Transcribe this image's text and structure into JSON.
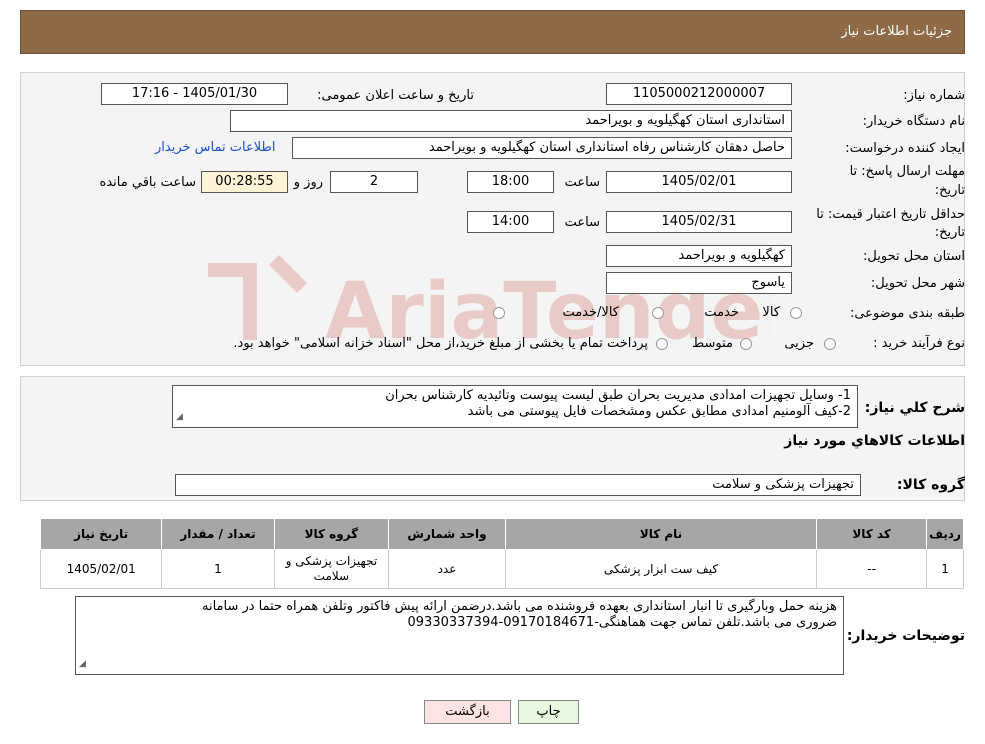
{
  "header": {
    "title": "جزئیات اطلاعات نیاز"
  },
  "form": {
    "need_number_label": "شماره نیاز:",
    "need_number": "1105000212000007",
    "announce_label": "تاریخ و ساعت اعلان عمومی:",
    "announce_value": "1405/01/30 - 17:16",
    "buyer_org_label": "نام دستگاه خریدار:",
    "buyer_org": "استانداری استان کهگیلویه و بویراحمد",
    "requester_label": "ایجاد کننده درخواست:",
    "requester": "حاصل دهقان کارشناس رفاه استانداری استان کهگیلویه و بویراحمد",
    "contact_link": "اطلاعات تماس خریدار",
    "deadline_label_1": "مهلت ارسال پاسخ: تا",
    "deadline_label_2": "تاریخ:",
    "deadline_date": "1405/02/01",
    "time_label": "ساعت",
    "deadline_time": "18:00",
    "days_value": "2",
    "days_label": "روز و",
    "remaining_value": "00:28:55",
    "remaining_label": "ساعت باقي مانده",
    "validity_label_1": "حداقل تاریخ اعتبار قیمت: تا",
    "validity_label_2": "تاریخ:",
    "validity_date": "1405/02/31",
    "validity_time": "14:00",
    "province_label": "استان محل تحویل:",
    "province": "کهگیلویه و بویراحمد",
    "city_label": "شهر محل تحویل:",
    "city": "یاسوج",
    "category_label": "طبقه بندی موضوعی:",
    "category_options": [
      "کالا",
      "خدمت",
      "کالا/خدمت"
    ],
    "process_label": "نوع فرآیند خرید :",
    "process_options": [
      "جزیی",
      "متوسط"
    ],
    "process_note": "پرداخت تمام یا بخشی از مبلغ خرید،از محل \"اسناد خزانه اسلامی\" خواهد بود."
  },
  "description": {
    "label": "شرح کلي نياز:",
    "line1": "1- وسایل تجهیزات امدادی مدیریت بحران  طبق لیست پیوست وتائیدیه کارشناس بحران",
    "line2": "2-کیف آلومنیم امدادی مطابق عکس ومشخصات فایل پیوستی می باشد"
  },
  "goods": {
    "section_title": "اطلاعات کالاهاي مورد نياز",
    "group_label": "گروه کالا:",
    "group_value": "تجهیزات پزشکی و سلامت"
  },
  "table": {
    "headers": [
      "ردیف",
      "کد کالا",
      "نام کالا",
      "واحد شمارش",
      "گروه کالا",
      "تعداد / مقدار",
      "تاریخ نیاز"
    ],
    "rows": [
      [
        "1",
        "--",
        "کیف ست ابزار پزشکی",
        "عدد",
        "تجهیزات پزشکی و سلامت",
        "1",
        "1405/02/01"
      ]
    ]
  },
  "buyer_notes": {
    "label": "توضیحات خریدار:",
    "line1": "هزینه حمل وبارگیری تا انبار استانداری بعهده فروشنده می باشد.درضمن ارائه پیش فاکتور وتلفن همراه حتما در سامانه",
    "line2": "ضروری می باشد.تلفن تماس جهت هماهنگی-09170184671-09330337394"
  },
  "buttons": {
    "print": "چاپ",
    "back": "بازگشت"
  },
  "watermark_text": "AriaTender.neT",
  "colors": {
    "header": "#8e6b46",
    "link": "#1a4fcf",
    "print_btn": "#e8f7df",
    "back_btn": "#fde3e3",
    "watermark": "#c0392b"
  }
}
